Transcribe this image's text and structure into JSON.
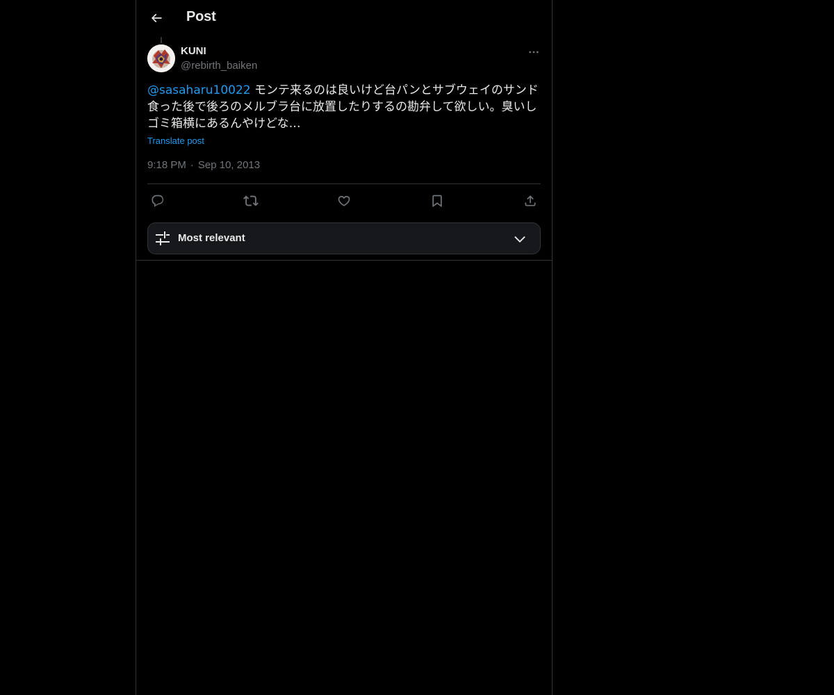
{
  "header": {
    "title": "Post",
    "back_icon": "arrow-left-icon"
  },
  "post": {
    "author": {
      "name": "KUNI",
      "handle": "@rebirth_baiken",
      "avatar_icon": "avatar-image"
    },
    "mention": "@sasaharu10022",
    "text": " モンテ来るのは良いけど台パンとサブウェイのサンド食った後で後ろのメルブラ台に放置したりするの勘弁して欲しい。臭いしゴミ箱横にあるんやけどな…",
    "translate_label": "Translate post",
    "time": "9:18 PM",
    "separator": "·",
    "date": "Sep 10, 2013"
  },
  "actions": [
    {
      "name": "reply",
      "icon": "reply-icon"
    },
    {
      "name": "repost",
      "icon": "repost-icon"
    },
    {
      "name": "like",
      "icon": "heart-icon"
    },
    {
      "name": "bookmark",
      "icon": "bookmark-icon"
    },
    {
      "name": "share",
      "icon": "share-icon"
    }
  ],
  "sort": {
    "label": "Most relevant",
    "icon": "sliders-icon",
    "chevron": "chevron-down-icon"
  },
  "colors": {
    "background": "#000000",
    "text": "#e7e9ea",
    "secondary_text": "#71767b",
    "accent": "#1d9bf0",
    "border": "#2f3336",
    "sort_background": "#16181c"
  }
}
